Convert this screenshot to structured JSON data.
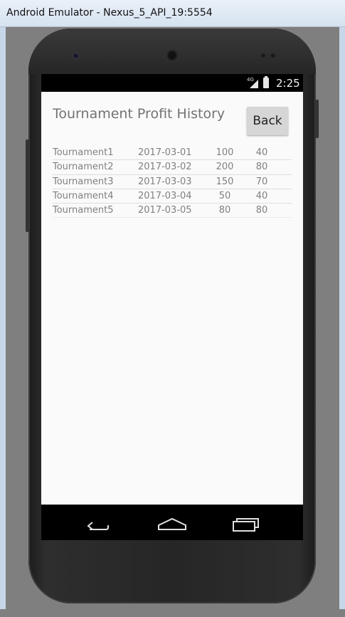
{
  "window": {
    "title": "Android Emulator - Nexus_5_API_19:5554"
  },
  "status_bar": {
    "network": "4G",
    "time": "2:25"
  },
  "screen": {
    "title": "Tournament Profit History",
    "back_label": "Back"
  },
  "history": {
    "rows": [
      {
        "name": "Tournament1",
        "date": "2017-03-01",
        "v1": "100",
        "v2": "40"
      },
      {
        "name": "Tournament2",
        "date": "2017-03-02",
        "v1": "200",
        "v2": "80"
      },
      {
        "name": "Tournament3",
        "date": "2017-03-03",
        "v1": "150",
        "v2": "70"
      },
      {
        "name": "Tournament4",
        "date": "2017-03-04",
        "v1": "50",
        "v2": "40"
      },
      {
        "name": "Tournament5",
        "date": "2017-03-05",
        "v1": "80",
        "v2": "80"
      }
    ]
  },
  "nav_bar": {
    "icons": [
      "back-icon",
      "home-icon",
      "recent-apps-icon"
    ]
  },
  "colors": {
    "screen_background": "#fafafa",
    "text_gray": "#808080",
    "button_gray": "#d6d6d6",
    "phone_body": "#262626"
  }
}
